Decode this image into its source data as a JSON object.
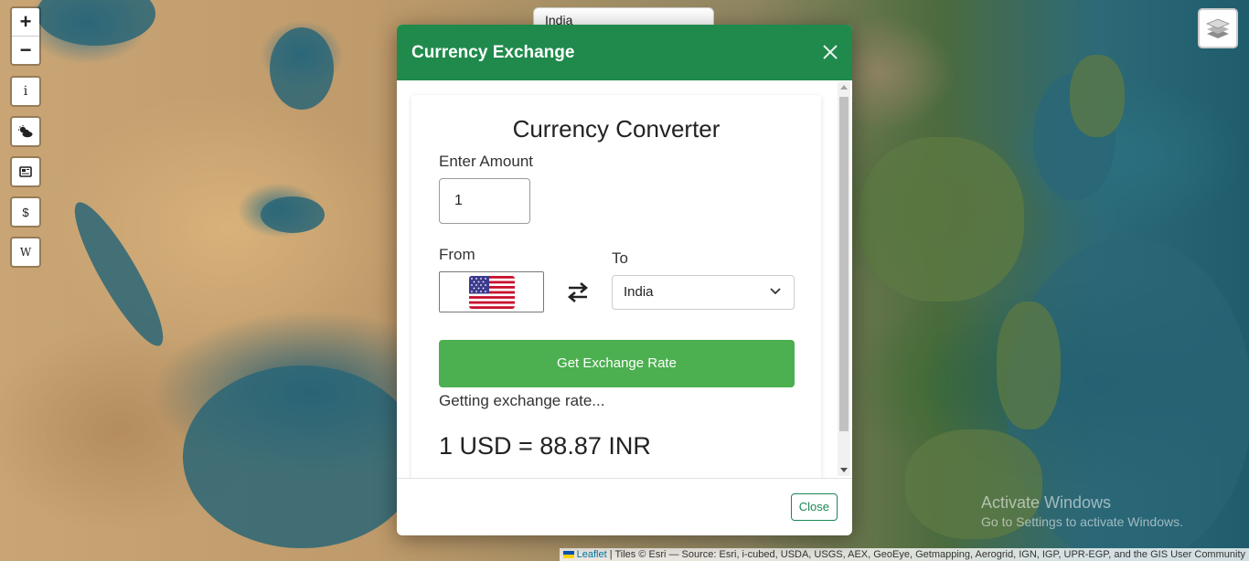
{
  "map": {
    "zoom_in_label": "+",
    "zoom_out_label": "−",
    "controls": [
      {
        "name": "info-control",
        "icon": "info-icon",
        "glyph": "i"
      },
      {
        "name": "weather-control",
        "icon": "weather-icon",
        "glyph": ""
      },
      {
        "name": "news-control",
        "icon": "newspaper-icon",
        "glyph": ""
      },
      {
        "name": "currency-control",
        "icon": "dollar-icon",
        "glyph": "$"
      },
      {
        "name": "wikipedia-control",
        "icon": "wikipedia-icon",
        "glyph": "W"
      }
    ],
    "country_select_value": "India",
    "attribution": {
      "leaflet": "Leaflet",
      "rest": "| Tiles © Esri — Source: Esri, i-cubed, USDA, USGS, AEX, GeoEye, Getmapping, Aerogrid, IGN, IGP, UPR-EGP, and the GIS User Community"
    },
    "watermark": {
      "line1": "Activate Windows",
      "line2": "Go to Settings to activate Windows."
    }
  },
  "modal": {
    "title": "Currency Exchange",
    "header_color": "#1f8a4c",
    "converter_title": "Currency Converter",
    "amount_label": "Enter Amount",
    "amount_value": "1",
    "from_label": "From",
    "from_flag": "us-flag-icon",
    "to_label": "To",
    "to_value": "India",
    "button_label": "Get Exchange Rate",
    "button_color": "#4caf50",
    "status_text": "Getting exchange rate...",
    "result_text": "1 USD = 88.87 INR",
    "close_label": "Close"
  }
}
